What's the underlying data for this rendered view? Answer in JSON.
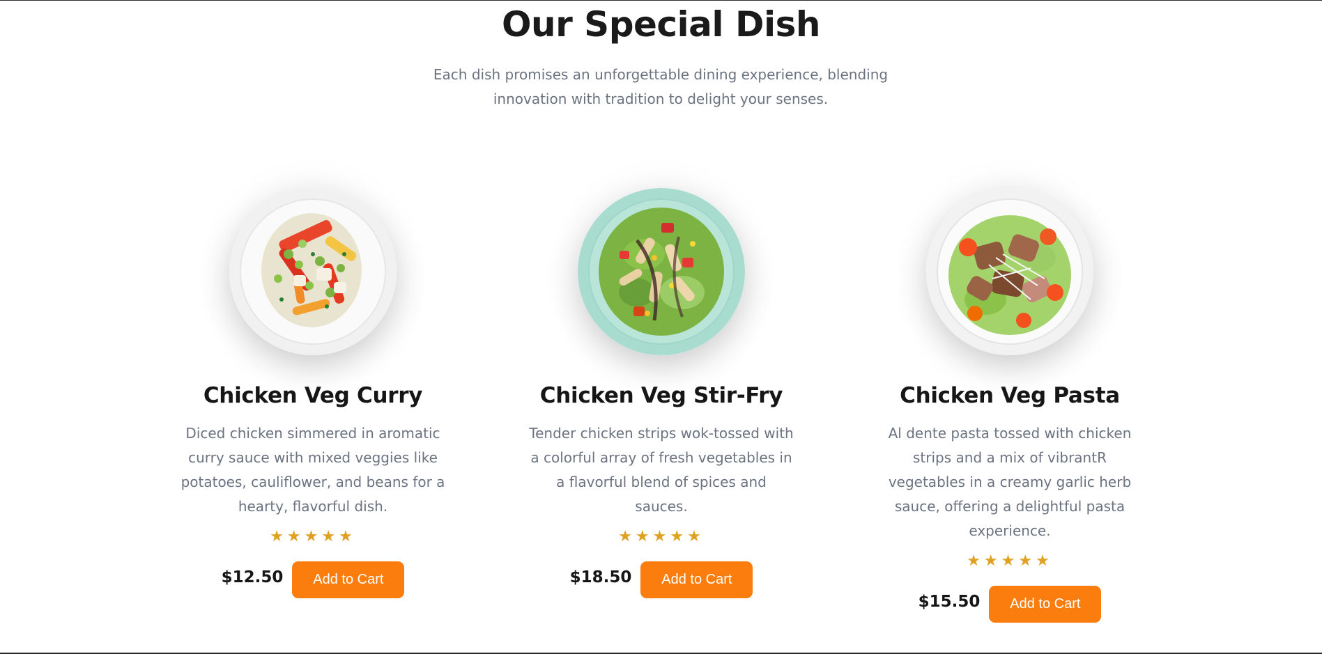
{
  "section": {
    "title": "Our Special Dish",
    "subtitle": "Each dish promises an unforgettable dining experience, blending innovation with tradition to delight your senses."
  },
  "theme": {
    "accent": "#fb7d0d",
    "star": "#e0a020",
    "heading": "#161616",
    "body_text": "#6b7280"
  },
  "dishes": [
    {
      "name": "Chicken Veg Curry",
      "description": "Diced chicken simmered in aromatic curry sauce with mixed veggies like potatoes, cauliflower, and beans for a hearty, flavorful dish.",
      "rating": 5,
      "stars": "★★★★★",
      "price": "$12.50",
      "button_label": "Add to Cart",
      "image_icon": "curry-plate-image"
    },
    {
      "name": "Chicken Veg Stir-Fry",
      "description": "Tender chicken strips wok-tossed with a colorful array of fresh vegetables in a flavorful blend of spices and sauces.",
      "rating": 5,
      "stars": "★★★★★",
      "price": "$18.50",
      "button_label": "Add to Cart",
      "image_icon": "stir-fry-plate-image"
    },
    {
      "name": "Chicken Veg Pasta",
      "description": "Al dente pasta tossed with chicken strips and a mix of vibrantR vegetables in a creamy garlic herb sauce, offering a delightful pasta experience.",
      "rating": 5,
      "stars": "★★★★★",
      "price": "$15.50",
      "button_label": "Add to Cart",
      "image_icon": "pasta-plate-image"
    }
  ]
}
